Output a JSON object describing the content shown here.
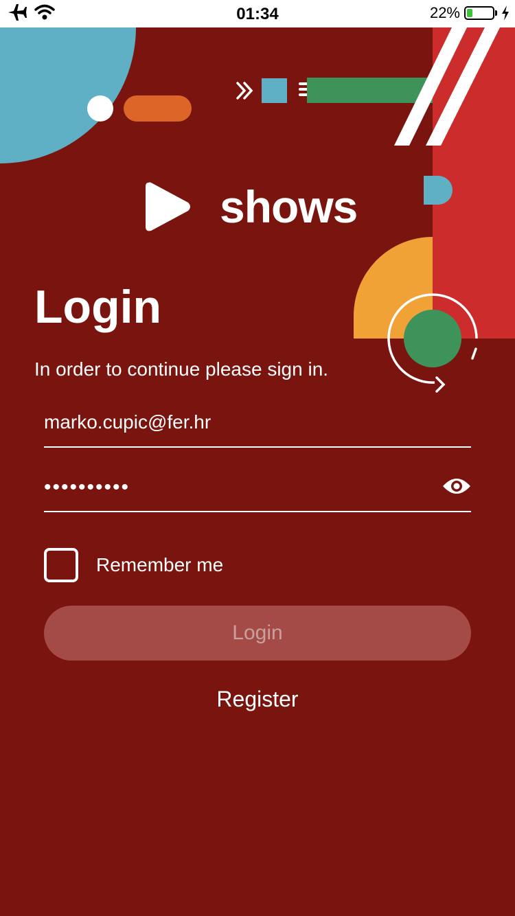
{
  "status_bar": {
    "time": "01:34",
    "battery_percent": "22%",
    "battery_level": 0.22,
    "icons": [
      "airplane-icon",
      "wifi-icon",
      "battery-icon",
      "charging-icon"
    ]
  },
  "logo": {
    "text": "shows",
    "icon": "play-icon"
  },
  "login": {
    "title": "Login",
    "subtitle": "In order to continue please sign in.",
    "email_value": "marko.cupic@fer.hr",
    "password_value": "••••••••••",
    "password_icon": "eye-icon",
    "remember_label": "Remember me",
    "remember_checked": false,
    "login_button": "Login",
    "register_link": "Register"
  },
  "colors": {
    "background": "#7a140f",
    "button_disabled": "#a54b47",
    "accent_blue": "#5fb0c5",
    "accent_orange": "#de6528",
    "accent_green": "#3e935a",
    "accent_red": "#cd2c2c",
    "accent_yellow": "#f0a237"
  }
}
